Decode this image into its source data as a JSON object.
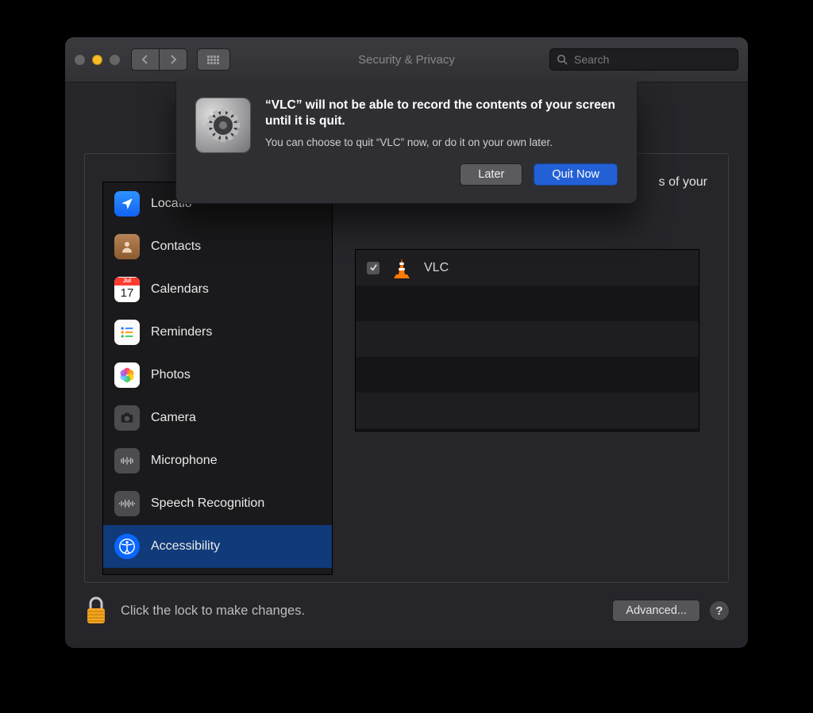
{
  "window": {
    "title": "Security & Privacy"
  },
  "search": {
    "placeholder": "Search"
  },
  "sidebar": {
    "items": [
      {
        "label": "Location Services",
        "label_truncated": "Locatio"
      },
      {
        "label": "Contacts"
      },
      {
        "label": "Calendars",
        "badge_day": "17",
        "badge_month": "Jul"
      },
      {
        "label": "Reminders"
      },
      {
        "label": "Photos"
      },
      {
        "label": "Camera"
      },
      {
        "label": "Microphone"
      },
      {
        "label": "Speech Recognition"
      },
      {
        "label": "Accessibility"
      }
    ]
  },
  "right": {
    "description_visible_fragment": "s of your",
    "description_full": "Allow the apps below to record the contents of your screen and audio, even while using other apps."
  },
  "apps": {
    "items": [
      {
        "name": "VLC",
        "checked": true
      }
    ]
  },
  "footer": {
    "lock_text": "Click the lock to make changes.",
    "advanced_label": "Advanced...",
    "help_label": "?"
  },
  "sheet": {
    "title": "“VLC” will not be able to record the contents of your screen until it is quit.",
    "message": "You can choose to quit “VLC” now, or do it on your own later.",
    "later_label": "Later",
    "quit_label": "Quit Now"
  }
}
